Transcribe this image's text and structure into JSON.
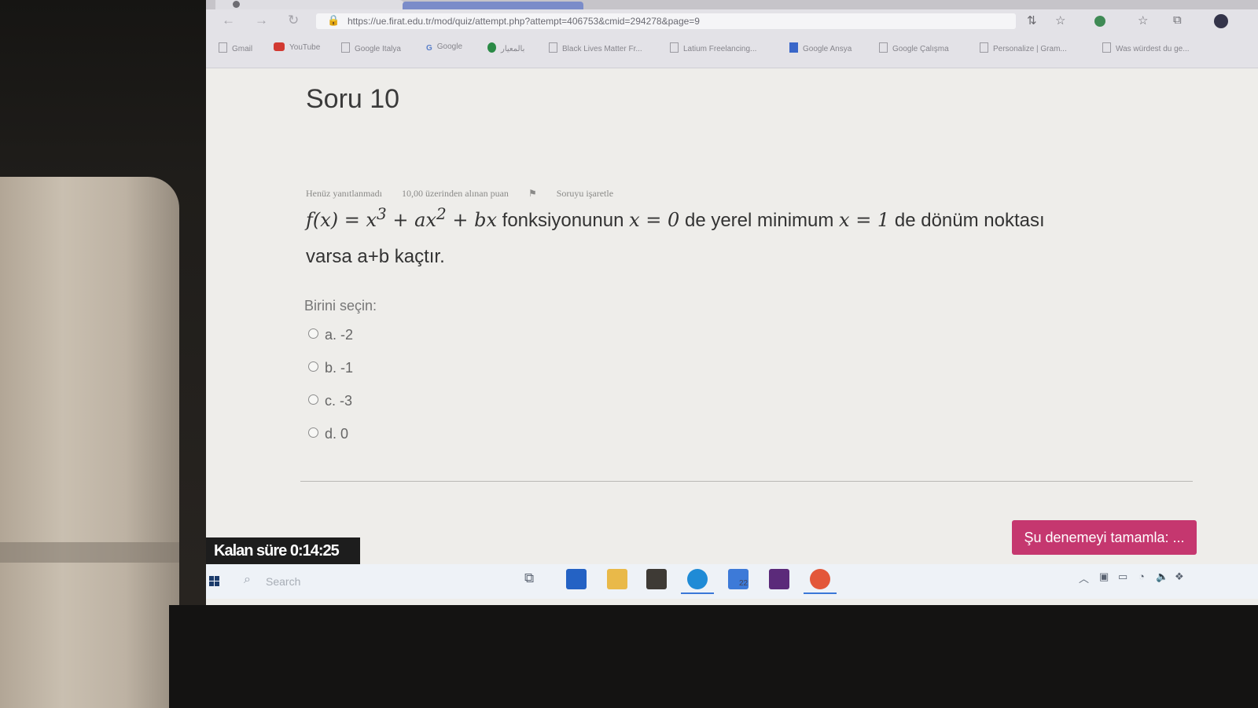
{
  "browser": {
    "url": "https://ue.firat.edu.tr/mod/quiz/attempt.php?attempt=406753&cmid=294278&page=9",
    "bookmarks": [
      {
        "label": "Gmail",
        "icon": "page-icon"
      },
      {
        "label": "YouTube",
        "icon": "youtube-icon"
      },
      {
        "label": "Google Italya",
        "icon": "page-icon"
      },
      {
        "label": "Google",
        "icon": "google-icon"
      },
      {
        "label": "بالمعيار",
        "icon": "green-circle-icon"
      },
      {
        "label": "Black Lives Matter Fr...",
        "icon": "page-icon"
      },
      {
        "label": "Latium Freelancing...",
        "icon": "page-icon"
      },
      {
        "label": "Google Ansya",
        "icon": "translate-icon"
      },
      {
        "label": "Google Çalışma",
        "icon": "page-icon"
      },
      {
        "label": "Personalize | Gram...",
        "icon": "page-icon"
      },
      {
        "label": "Was würdest du ge...",
        "icon": "page-icon"
      }
    ]
  },
  "question": {
    "title": "Soru 10",
    "meta": {
      "status": "Henüz yanıtlanmadı",
      "points": "10,00 üzerinden alınan puan",
      "flag": "Soruyu işaretle"
    },
    "text_fx": "f(x) = x",
    "text_exp3": "3",
    "text_ax": " + ax",
    "text_exp2": "2",
    "text_bx": " + bx",
    "text_mid1": " fonksiyonunun ",
    "text_x0": "x = 0",
    "text_mid2": " de yerel minimum ",
    "text_x1": "x = 1",
    "text_mid3": " de dönüm noktası",
    "text_line2": "varsa a+b kaçtır.",
    "choose_label": "Birini seçin:",
    "options": [
      "a. -2",
      "b. -1",
      "c. -3",
      "d. 0"
    ]
  },
  "finish_button": "Şu denemeyi tamamla: ...",
  "timer": "Kalan süre 0:14:25",
  "taskbar": {
    "search_placeholder": "Search",
    "mail_count": "22"
  },
  "colors": {
    "finish_button": "#c5376f",
    "timer_bg": "#1d1d1d"
  }
}
